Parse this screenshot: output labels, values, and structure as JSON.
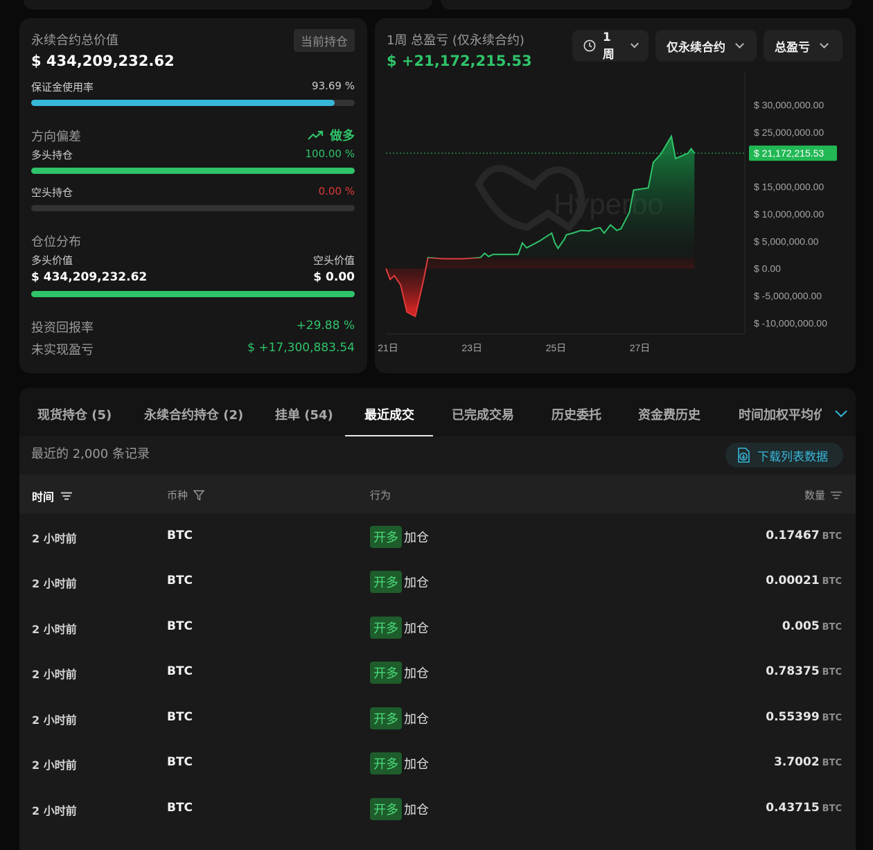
{
  "summary": {
    "perp_total_label": "永续合约总价值",
    "current_positions_label": "当前持仓",
    "perp_total_value": "$ 434,209,232.62",
    "margin_usage_label": "保证金使用率",
    "margin_usage_pct": "93.69 %",
    "margin_usage_fraction": 0.9369,
    "direction_label": "方向偏差",
    "direction_value": "做多",
    "long_pos_label": "多头持仓",
    "long_pos_pct": "100.00 %",
    "long_pos_fraction": 1.0,
    "short_pos_label": "空头持仓",
    "short_pos_pct": "0.00 %",
    "short_pos_fraction": 0.0,
    "distribution_label": "仓位分布",
    "long_value_label": "多头价值",
    "long_value": "$ 434,209,232.62",
    "short_value_label": "空头价值",
    "short_value": "$ 0.00",
    "distribution_long_fraction": 1.0,
    "roi_label": "投资回报率",
    "roi_value": "+29.88 %",
    "unrealized_label": "未实现盈亏",
    "unrealized_value": "$ +17,300,883.54"
  },
  "pnl": {
    "title": "1周 总盈亏 (仅永续合约)",
    "value": "$ +21,172,215.53",
    "controls": {
      "period": "1周",
      "scope": "仅永续合约",
      "metric": "总盈亏"
    },
    "watermark": "Hyperbo",
    "current_tag": "$ 21,172,215.53"
  },
  "chart_data": {
    "type": "area",
    "title": "1周 总盈亏 (仅永续合约)",
    "ylim": [
      -12000000,
      32000000
    ],
    "y_ticks": [
      30000000,
      25000000,
      15000000,
      10000000,
      5000000,
      0,
      -5000000,
      -10000000
    ],
    "y_tick_labels": [
      "$ 30,000,000.00",
      "$ 25,000,000.00",
      "$ 15,000,000.00",
      "$ 10,000,000.00",
      "$ 5,000,000.00",
      "$ 0.00",
      "$ -5,000,000.00",
      "$ -10,000,000.00"
    ],
    "x_ticks": [
      21,
      23,
      25,
      27
    ],
    "x_tick_labels": [
      "21日",
      "23日",
      "25日",
      "27日"
    ],
    "xlim": [
      20.95,
      29.5
    ],
    "current_value": 21172215.53,
    "points": [
      [
        20.95,
        0
      ],
      [
        21.05,
        -2000000
      ],
      [
        21.15,
        -1300000
      ],
      [
        21.3,
        -3000000
      ],
      [
        21.45,
        -8000000
      ],
      [
        21.65,
        -8800000
      ],
      [
        21.85,
        -2000000
      ],
      [
        21.95,
        2000000
      ],
      [
        22.3,
        1800000
      ],
      [
        22.8,
        1800000
      ],
      [
        23.2,
        2000000
      ],
      [
        23.3,
        2800000
      ],
      [
        23.4,
        2200000
      ],
      [
        23.5,
        2600000
      ],
      [
        23.8,
        2600000
      ],
      [
        24.1,
        2600000
      ],
      [
        24.2,
        4700000
      ],
      [
        24.3,
        3800000
      ],
      [
        24.6,
        5000000
      ],
      [
        24.9,
        6500000
      ],
      [
        24.97,
        4800000
      ],
      [
        25.05,
        3700000
      ],
      [
        25.2,
        5400000
      ],
      [
        25.25,
        6200000
      ],
      [
        25.4,
        6500000
      ],
      [
        25.6,
        7000000
      ],
      [
        25.8,
        6900000
      ],
      [
        25.92,
        7300000
      ],
      [
        26.05,
        7500000
      ],
      [
        26.15,
        6500000
      ],
      [
        26.3,
        8000000
      ],
      [
        26.45,
        7000000
      ],
      [
        26.55,
        7300000
      ],
      [
        26.75,
        10300000
      ],
      [
        26.85,
        14400000
      ],
      [
        27.2,
        14800000
      ],
      [
        27.32,
        19500000
      ],
      [
        27.5,
        21000000
      ],
      [
        27.75,
        24300000
      ],
      [
        27.85,
        20200000
      ],
      [
        28.15,
        21172215.53
      ],
      [
        28.22,
        22000000
      ],
      [
        28.3,
        21172215.53
      ]
    ]
  },
  "tabs": [
    {
      "label": "现货持仓 (5)"
    },
    {
      "label": "永续合约持仓 (2)"
    },
    {
      "label": "挂单 (54)"
    },
    {
      "label": "最近成交"
    },
    {
      "label": "已完成交易"
    },
    {
      "label": "历史委托"
    },
    {
      "label": "资金费历史"
    },
    {
      "label": "时间加权平均价"
    }
  ],
  "records": {
    "count_label": "最近的 2,000 条记录",
    "download_label": "下载列表数据"
  },
  "table": {
    "headers": {
      "time": "时间",
      "coin": "币种",
      "action": "行为",
      "qty": "数量"
    },
    "rows": [
      {
        "time": "2 小时前",
        "coin": "BTC",
        "badge": "开多",
        "action": "加仓",
        "qty": "0.17467",
        "unit": "BTC"
      },
      {
        "time": "2 小时前",
        "coin": "BTC",
        "badge": "开多",
        "action": "加仓",
        "qty": "0.00021",
        "unit": "BTC"
      },
      {
        "time": "2 小时前",
        "coin": "BTC",
        "badge": "开多",
        "action": "加仓",
        "qty": "0.005",
        "unit": "BTC"
      },
      {
        "time": "2 小时前",
        "coin": "BTC",
        "badge": "开多",
        "action": "加仓",
        "qty": "0.78375",
        "unit": "BTC"
      },
      {
        "time": "2 小时前",
        "coin": "BTC",
        "badge": "开多",
        "action": "加仓",
        "qty": "0.55399",
        "unit": "BTC"
      },
      {
        "time": "2 小时前",
        "coin": "BTC",
        "badge": "开多",
        "action": "加仓",
        "qty": "3.7002",
        "unit": "BTC"
      },
      {
        "time": "2 小时前",
        "coin": "BTC",
        "badge": "开多",
        "action": "加仓",
        "qty": "0.43715",
        "unit": "BTC"
      }
    ]
  },
  "colors": {
    "accent_green": "#2fc36a",
    "accent_red": "#e03a3a",
    "margin_bar": "#38b7d9"
  }
}
